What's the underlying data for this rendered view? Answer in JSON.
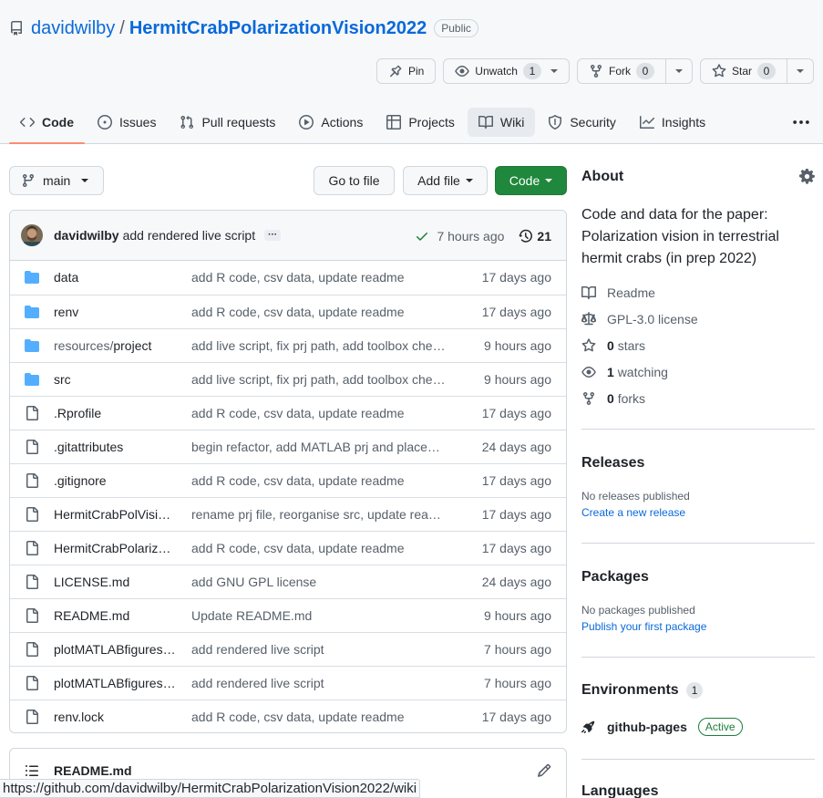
{
  "repo": {
    "owner": "davidwilby",
    "separator": "/",
    "name": "HermitCrabPolarizationVision2022",
    "visibility": "Public"
  },
  "repo_actions": {
    "pin_label": "Pin",
    "watch_label": "Unwatch",
    "watch_count": "1",
    "fork_label": "Fork",
    "fork_count": "0",
    "star_label": "Star",
    "star_count": "0"
  },
  "tabs": [
    {
      "label": "Code",
      "icon": "code-icon",
      "active": true
    },
    {
      "label": "Issues",
      "icon": "issue-icon"
    },
    {
      "label": "Pull requests",
      "icon": "pull-request-icon"
    },
    {
      "label": "Actions",
      "icon": "play-icon"
    },
    {
      "label": "Projects",
      "icon": "table-icon"
    },
    {
      "label": "Wiki",
      "icon": "book-icon",
      "hovered": true
    },
    {
      "label": "Security",
      "icon": "shield-icon"
    },
    {
      "label": "Insights",
      "icon": "graph-icon"
    }
  ],
  "toolbar": {
    "branch": "main",
    "go_to_file": "Go to file",
    "add_file": "Add file",
    "code": "Code"
  },
  "latest_commit": {
    "author": "davidwilby",
    "message": "add rendered live script",
    "ellipsis": "···",
    "time": "7 hours ago",
    "commit_count": "21"
  },
  "files": [
    {
      "type": "folder",
      "name": "data",
      "message": "add R code, csv data, update readme",
      "age": "17 days ago"
    },
    {
      "type": "folder",
      "name": "renv",
      "message": "add R code, csv data, update readme",
      "age": "17 days ago"
    },
    {
      "type": "folder",
      "name_prefix": "resources/",
      "name": "project",
      "message": "add live script, fix prj path, add toolbox che…",
      "age": "9 hours ago"
    },
    {
      "type": "folder",
      "name": "src",
      "message": "add live script, fix prj path, add toolbox che…",
      "age": "9 hours ago"
    },
    {
      "type": "file",
      "name": ".Rprofile",
      "message": "add R code, csv data, update readme",
      "age": "17 days ago"
    },
    {
      "type": "file",
      "name": ".gitattributes",
      "message": "begin refactor, add MATLAB prj and place…",
      "age": "24 days ago"
    },
    {
      "type": "file",
      "name": ".gitignore",
      "message": "add R code, csv data, update readme",
      "age": "17 days ago"
    },
    {
      "type": "file",
      "name": "HermitCrabPolVisi…",
      "message": "rename prj file, reorganise src, update rea…",
      "age": "17 days ago"
    },
    {
      "type": "file",
      "name": "HermitCrabPolariz…",
      "message": "add R code, csv data, update readme",
      "age": "17 days ago"
    },
    {
      "type": "file",
      "name": "LICENSE.md",
      "message": "add GNU GPL license",
      "age": "24 days ago"
    },
    {
      "type": "file",
      "name": "README.md",
      "message": "Update README.md",
      "age": "9 hours ago"
    },
    {
      "type": "file",
      "name": "plotMATLABfigures…",
      "message": "add rendered live script",
      "age": "7 hours ago"
    },
    {
      "type": "file",
      "name": "plotMATLABfigures…",
      "message": "add rendered live script",
      "age": "7 hours ago"
    },
    {
      "type": "file",
      "name": "renv.lock",
      "message": "add R code, csv data, update readme",
      "age": "17 days ago"
    }
  ],
  "readme": {
    "title": "README.md"
  },
  "about": {
    "title": "About",
    "description": "Code and data for the paper: Polarization vision in terrestrial hermit crabs (in prep 2022)",
    "readme_label": "Readme",
    "license_label": "GPL-3.0 license",
    "stars_count": "0",
    "stars_label": "stars",
    "watching_count": "1",
    "watching_label": "watching",
    "forks_count": "0",
    "forks_label": "forks"
  },
  "releases": {
    "title": "Releases",
    "empty": "No releases published",
    "link": "Create a new release"
  },
  "packages": {
    "title": "Packages",
    "empty": "No packages published",
    "link": "Publish your first package"
  },
  "environments": {
    "title": "Environments",
    "count": "1",
    "name": "github-pages",
    "status": "Active"
  },
  "languages": {
    "title": "Languages"
  },
  "status_url": "https://github.com/davidwilby/HermitCrabPolarizationVision2022/wiki"
}
